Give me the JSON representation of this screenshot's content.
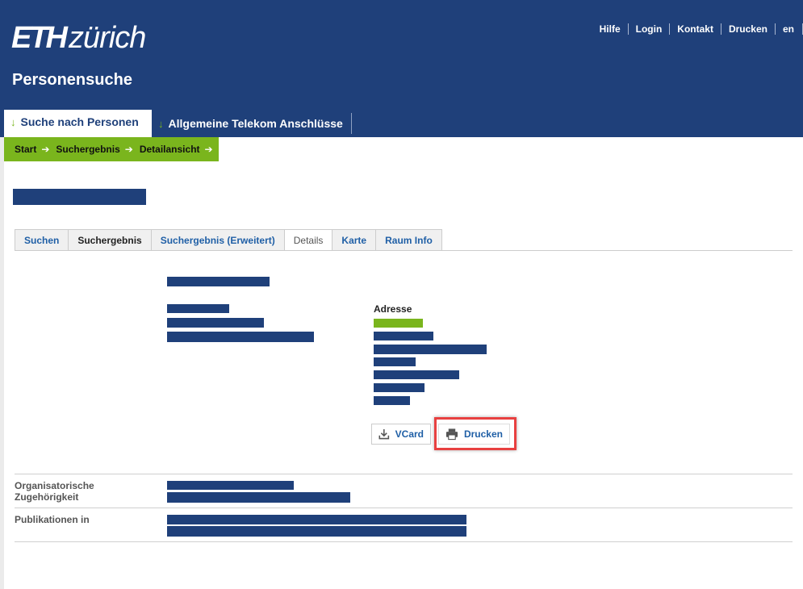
{
  "header": {
    "logo_eth": "ETH",
    "logo_zurich": "zürich",
    "title": "Personensuche",
    "colors": {
      "brand": "#1f407a",
      "accent": "#7ab51d"
    }
  },
  "top_nav": [
    "Hilfe",
    "Login",
    "Kontakt",
    "Drucken",
    "en"
  ],
  "main_nav": {
    "items": [
      {
        "label": "Suche nach Personen",
        "active": true
      },
      {
        "label": "Allgemeine Telekom Anschlüsse",
        "active": false
      }
    ],
    "arrow_icon": "arrow-down-icon"
  },
  "breadcrumb": [
    "Start",
    "Suchergebnis",
    "Detailansicht"
  ],
  "tabs": [
    {
      "label": "Suchen"
    },
    {
      "label": "Suchergebnis"
    },
    {
      "label": "Suchergebnis (Erweitert)"
    },
    {
      "label": "Details",
      "active": true
    },
    {
      "label": "Karte"
    },
    {
      "label": "Raum Info"
    }
  ],
  "details": {
    "address_label": "Adresse",
    "vcard_label": "VCard",
    "print_label": "Drucken"
  },
  "rows": {
    "org_label_line1": "Organisatorische",
    "org_label_line2": "Zugehörigkeit",
    "publications_label": "Publikationen in"
  }
}
